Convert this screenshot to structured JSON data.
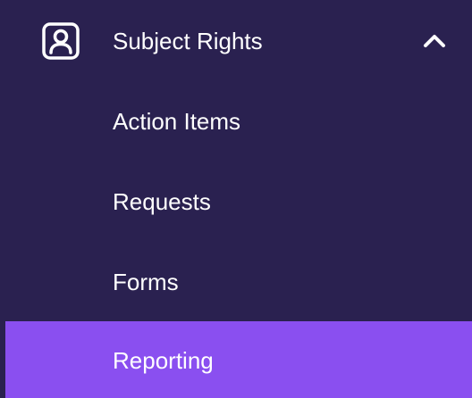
{
  "nav": {
    "group": {
      "label": "Subject Rights",
      "icon": "user-profile-icon",
      "expanded": true,
      "chevron_icon": "chevron-up-icon"
    },
    "items": [
      {
        "label": "Action Items",
        "active": false
      },
      {
        "label": "Requests",
        "active": false
      },
      {
        "label": "Forms",
        "active": false
      },
      {
        "label": "Reporting",
        "active": true
      }
    ]
  },
  "colors": {
    "background": "#2a2150",
    "active_background": "#8a4ff0",
    "text": "#ffffff"
  }
}
